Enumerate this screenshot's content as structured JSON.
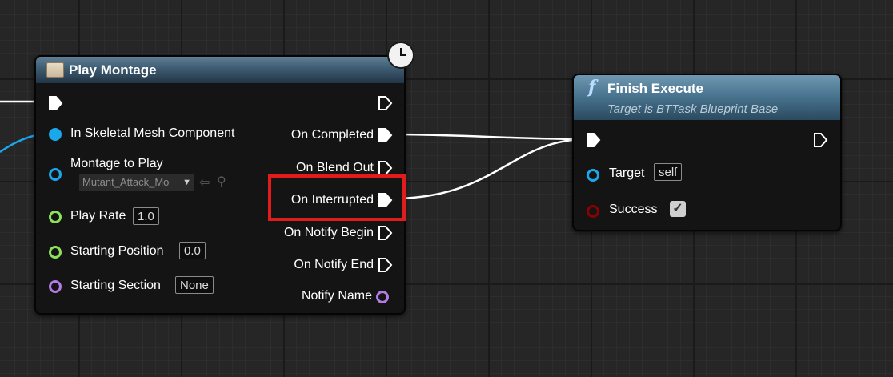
{
  "play_montage": {
    "title": "Play Montage",
    "inputs": {
      "skeletal_mesh": "In Skeletal Mesh Component",
      "montage_label": "Montage to Play",
      "montage_value": "Mutant_Attack_Mo",
      "play_rate_label": "Play Rate",
      "play_rate_value": "1.0",
      "start_pos_label": "Starting Position",
      "start_pos_value": "0.0",
      "start_section_label": "Starting Section",
      "start_section_value": "None"
    },
    "outputs": {
      "on_completed": "On Completed",
      "on_blend_out": "On Blend Out",
      "on_interrupted": "On Interrupted",
      "on_notify_begin": "On Notify Begin",
      "on_notify_end": "On Notify End",
      "notify_name": "Notify Name"
    }
  },
  "finish_execute": {
    "title": "Finish Execute",
    "subtitle": "Target is BTTask Blueprint Base",
    "target_label": "Target",
    "target_value": "self",
    "success_label": "Success",
    "success_checked": true
  },
  "colors": {
    "exec": "#ffffff",
    "object_pin": "#1aa7ec",
    "float_pin": "#8de15a",
    "name_pin": "#b37be5",
    "bool_pin": "#8b0000",
    "highlight": "#e01c1c"
  },
  "icons": {
    "function": "function-f-icon",
    "latent": "clock-icon",
    "anim": "anim-montage-icon",
    "checkbox": "checkmark-icon"
  }
}
